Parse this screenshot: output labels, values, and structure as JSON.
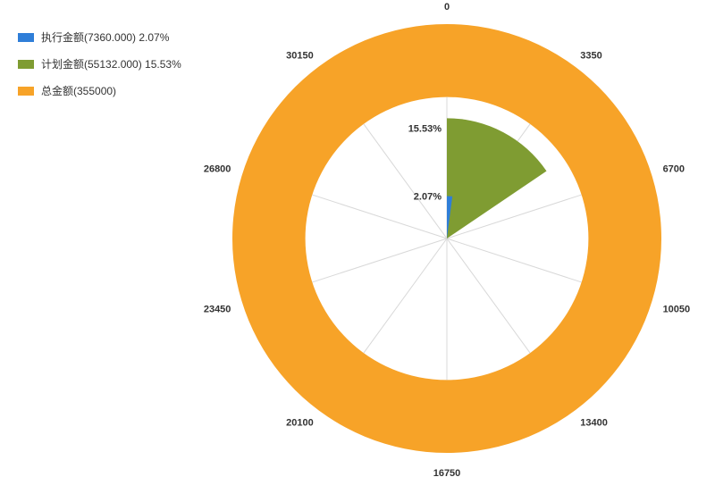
{
  "legend": {
    "items": [
      {
        "label": "执行金额(7360.000) 2.07%",
        "color": "#2f7ed8"
      },
      {
        "label": "计划金额(55132.000) 15.53%",
        "color": "#7f9c32"
      },
      {
        "label": "总金额(355000)",
        "color": "#f7a328"
      }
    ]
  },
  "chart_data": {
    "type": "pie",
    "variant": "nightingale_polar",
    "axis_max": 33500,
    "tick_labels": [
      "0",
      "3350",
      "6700",
      "10050",
      "13400",
      "16750",
      "20100",
      "23450",
      "26800",
      "30150"
    ],
    "series": [
      {
        "name": "执行金额",
        "value": 7360,
        "total": 355000,
        "percent": 2.07,
        "percent_label": "2.07%",
        "color": "#2f7ed8"
      },
      {
        "name": "计划金额",
        "value": 55132,
        "total": 355000,
        "percent": 15.53,
        "percent_label": "15.53%",
        "color": "#7f9c32"
      },
      {
        "name": "总金额",
        "value": 355000,
        "total": 355000,
        "percent": 100.0,
        "percent_label": "",
        "color": "#f7a328"
      }
    ],
    "annotations": [
      {
        "text": "15.53%",
        "series": "计划金额"
      },
      {
        "text": "2.07%",
        "series": "执行金额"
      }
    ]
  },
  "colors": {
    "spoke": "#d8d8d8",
    "bg": "#ffffff"
  }
}
